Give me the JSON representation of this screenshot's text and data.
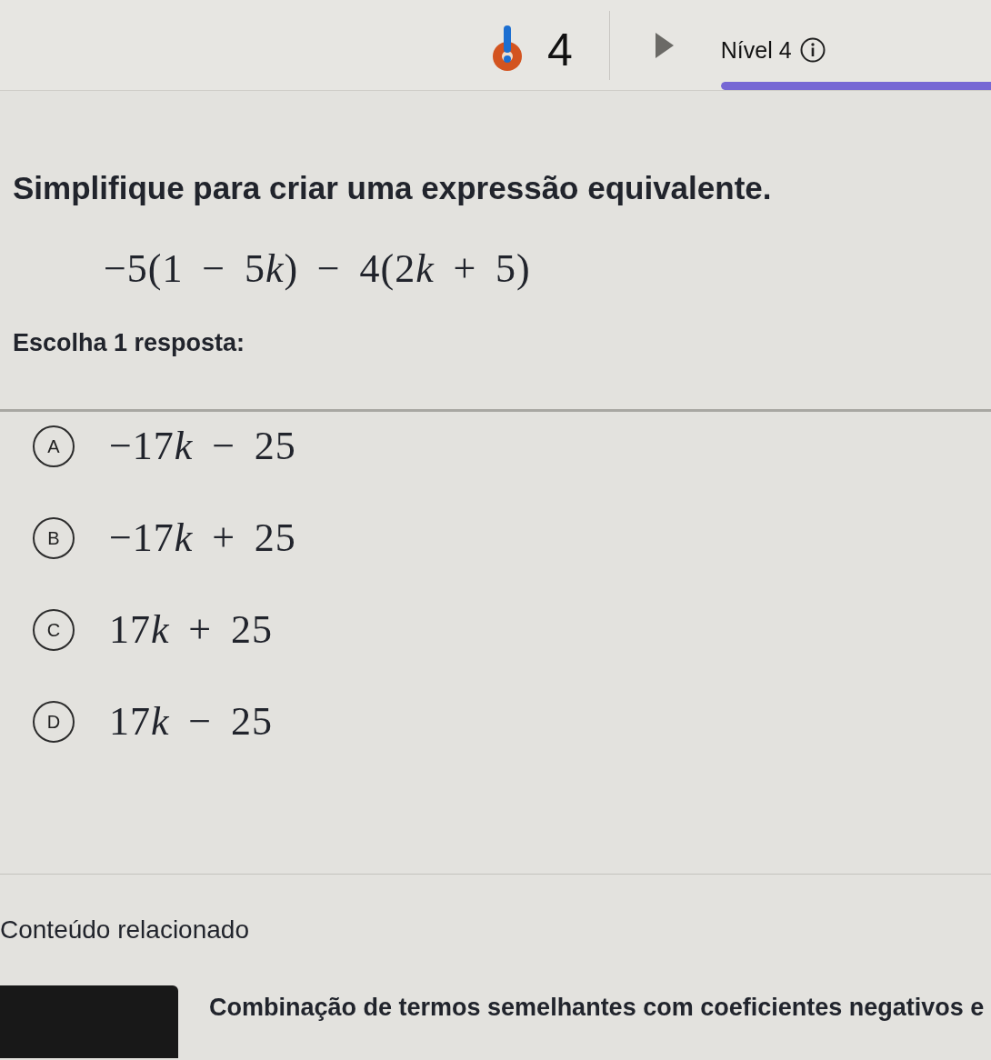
{
  "header": {
    "streak": "4",
    "level_label": "Nível 4",
    "progress": {
      "level": 1
    }
  },
  "question": {
    "prompt": "Simplifique para criar uma expressão equivalente.",
    "expression": [
      {
        "kind": "text",
        "text": "−5(1 − 5"
      },
      {
        "kind": "variable",
        "text": "k"
      },
      {
        "kind": "text",
        "text": ") − 4(2"
      },
      {
        "kind": "variable",
        "text": "k"
      },
      {
        "kind": "text",
        "text": " + 5)"
      }
    ],
    "instruction": "Escolha 1 resposta:"
  },
  "choices": [
    {
      "letter": "A",
      "answer": [
        {
          "kind": "text",
          "text": "−17"
        },
        {
          "kind": "variable",
          "text": "k"
        },
        {
          "kind": "text",
          "text": " − 25"
        }
      ],
      "selected": false
    },
    {
      "letter": "B",
      "answer": [
        {
          "kind": "text",
          "text": "−17"
        },
        {
          "kind": "variable",
          "text": "k"
        },
        {
          "kind": "text",
          "text": " + 25"
        }
      ],
      "selected": false
    },
    {
      "letter": "C",
      "answer": [
        {
          "kind": "text",
          "text": "17"
        },
        {
          "kind": "variable",
          "text": "k"
        },
        {
          "kind": "text",
          "text": " + 25"
        }
      ],
      "selected": false
    },
    {
      "letter": "D",
      "answer": [
        {
          "kind": "text",
          "text": "17"
        },
        {
          "kind": "variable",
          "text": "k"
        },
        {
          "kind": "text",
          "text": " − 25"
        }
      ],
      "selected": false
    }
  ],
  "related": {
    "heading": "Conteúdo relacionado",
    "items": [
      {
        "title": "Combinação de termos semelhantes com coeficientes negativos e"
      }
    ]
  }
}
